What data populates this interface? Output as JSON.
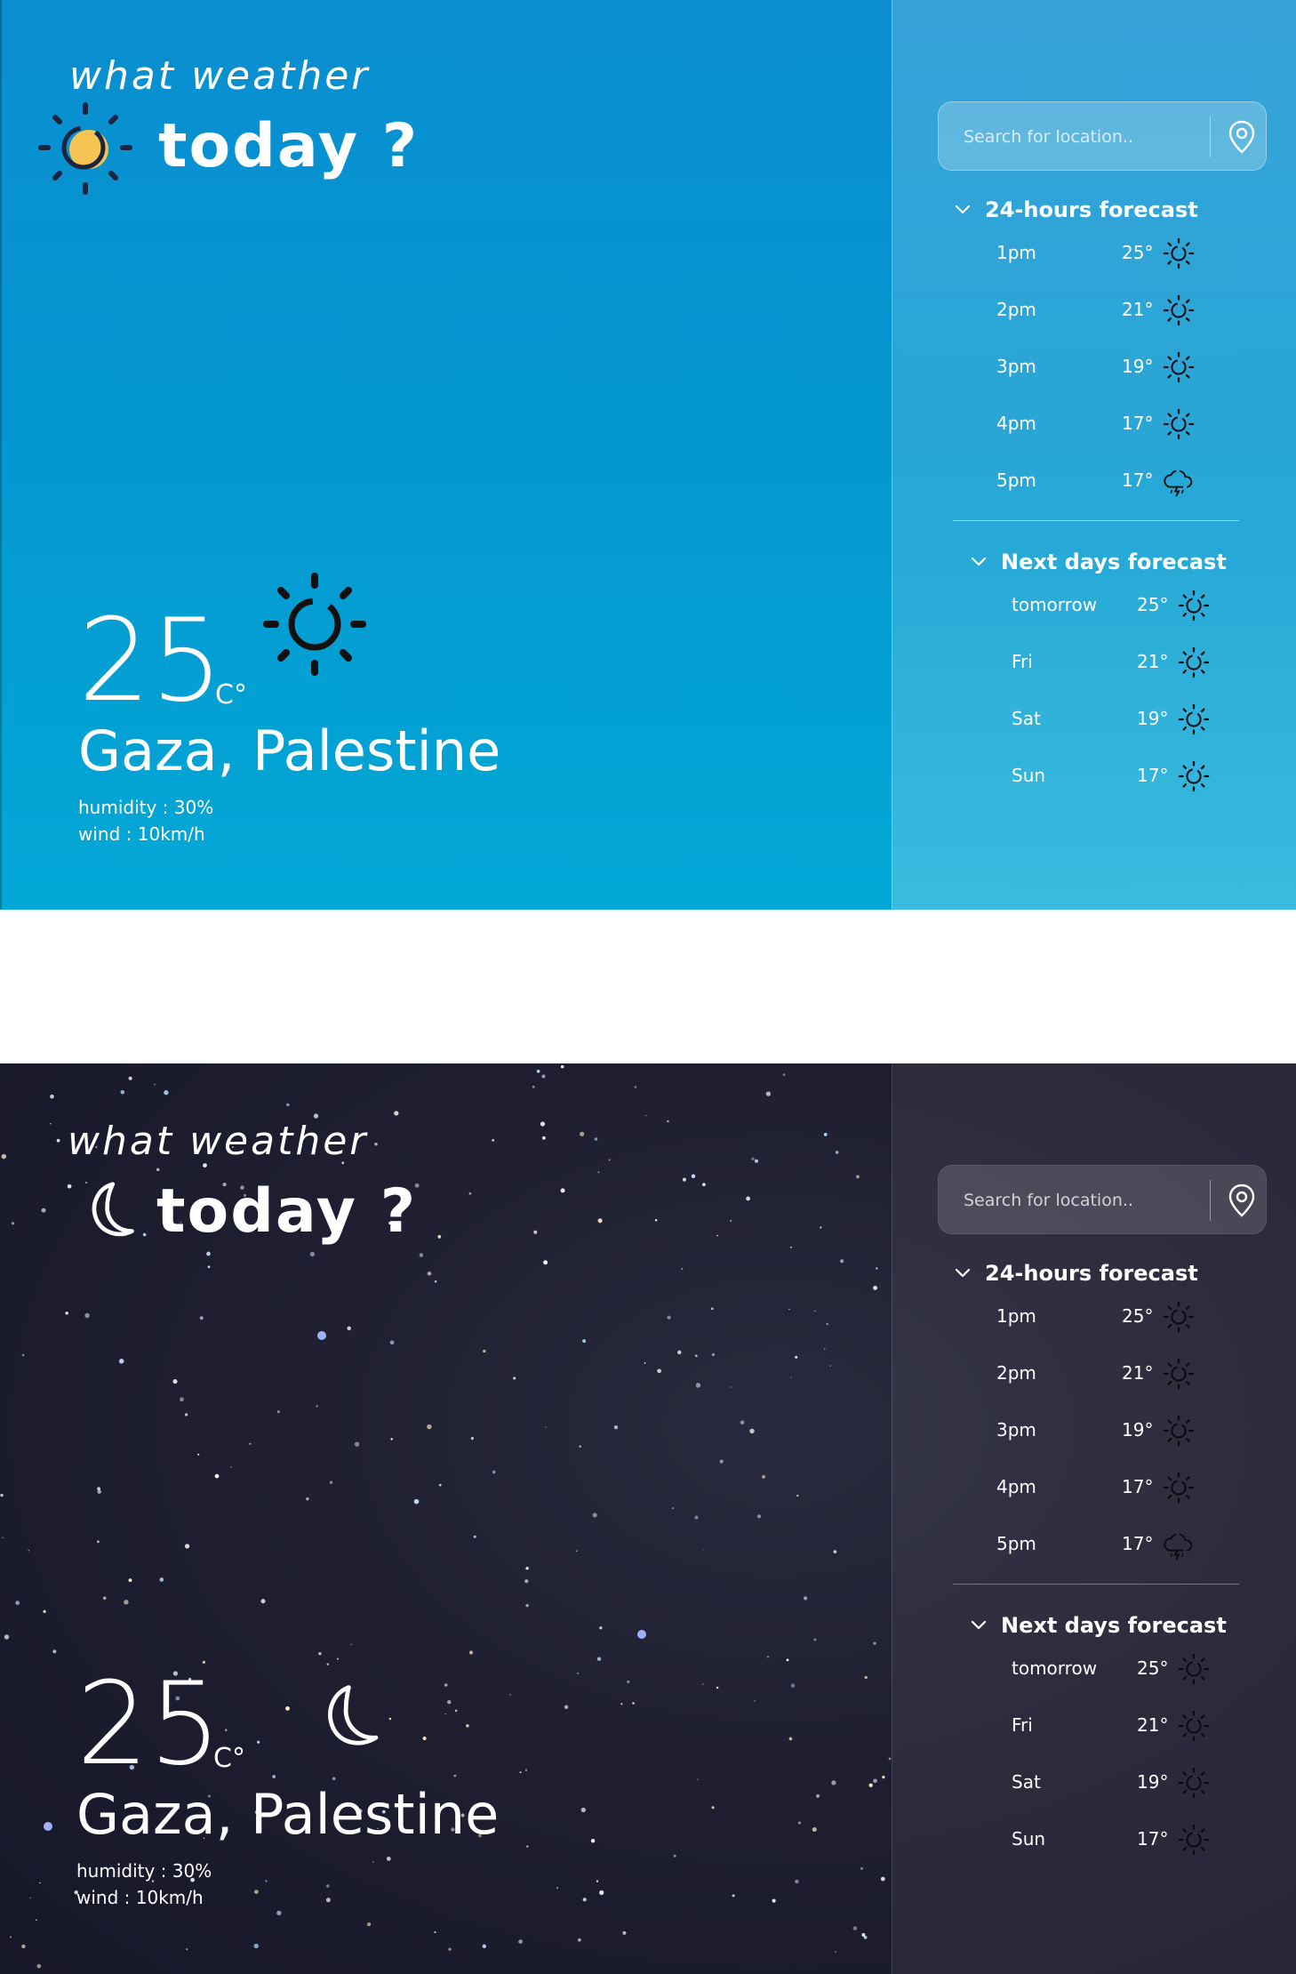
{
  "day": {
    "brand": {
      "line1": "what weather",
      "line2": "today ?"
    },
    "search": {
      "placeholder": "Search for location.."
    },
    "current": {
      "temp": "25",
      "unit": "C°",
      "city": "Gaza, Palestine",
      "humidity": "humidity : 30%",
      "wind": "wind : 10km/h"
    },
    "hours_title": "24-hours forecast",
    "hours": [
      {
        "time": "1pm",
        "temp": "25°",
        "icon": "sun-icon"
      },
      {
        "time": "2pm",
        "temp": "21°",
        "icon": "sun-icon"
      },
      {
        "time": "3pm",
        "temp": "19°",
        "icon": "sun-icon"
      },
      {
        "time": "4pm",
        "temp": "17°",
        "icon": "sun-icon"
      },
      {
        "time": "5pm",
        "temp": "17°",
        "icon": "storm-cloud-icon"
      }
    ],
    "days_title": "Next days forecast",
    "days": [
      {
        "day": "tomorrow",
        "temp": "25°",
        "icon": "sun-icon"
      },
      {
        "day": "Fri",
        "temp": "21°",
        "icon": "sun-icon"
      },
      {
        "day": "Sat",
        "temp": "19°",
        "icon": "sun-icon"
      },
      {
        "day": "Sun",
        "temp": "17°",
        "icon": "sun-icon"
      }
    ]
  },
  "night": {
    "brand": {
      "line1": "what weather",
      "line2": "today ?"
    },
    "search": {
      "placeholder": "Search for location.."
    },
    "current": {
      "temp": "25",
      "unit": "C°",
      "city": "Gaza, Palestine",
      "humidity": "humidity : 30%",
      "wind": "wind : 10km/h"
    },
    "hours_title": "24-hours forecast",
    "hours": [
      {
        "time": "1pm",
        "temp": "25°",
        "icon": "sun-icon"
      },
      {
        "time": "2pm",
        "temp": "21°",
        "icon": "sun-icon"
      },
      {
        "time": "3pm",
        "temp": "19°",
        "icon": "sun-icon"
      },
      {
        "time": "4pm",
        "temp": "17°",
        "icon": "sun-icon"
      },
      {
        "time": "5pm",
        "temp": "17°",
        "icon": "storm-cloud-icon"
      }
    ],
    "days_title": "Next days forecast",
    "days": [
      {
        "day": "tomorrow",
        "temp": "25°",
        "icon": "sun-icon"
      },
      {
        "day": "Fri",
        "temp": "21°",
        "icon": "sun-icon"
      },
      {
        "day": "Sat",
        "temp": "19°",
        "icon": "sun-icon"
      },
      {
        "day": "Sun",
        "temp": "17°",
        "icon": "sun-icon"
      }
    ]
  },
  "colors": {
    "day_sky": "#0a8ed0",
    "night_sky": "#1f1f31",
    "sun_accent": "#f6c453",
    "icon_dark": "#111111"
  }
}
